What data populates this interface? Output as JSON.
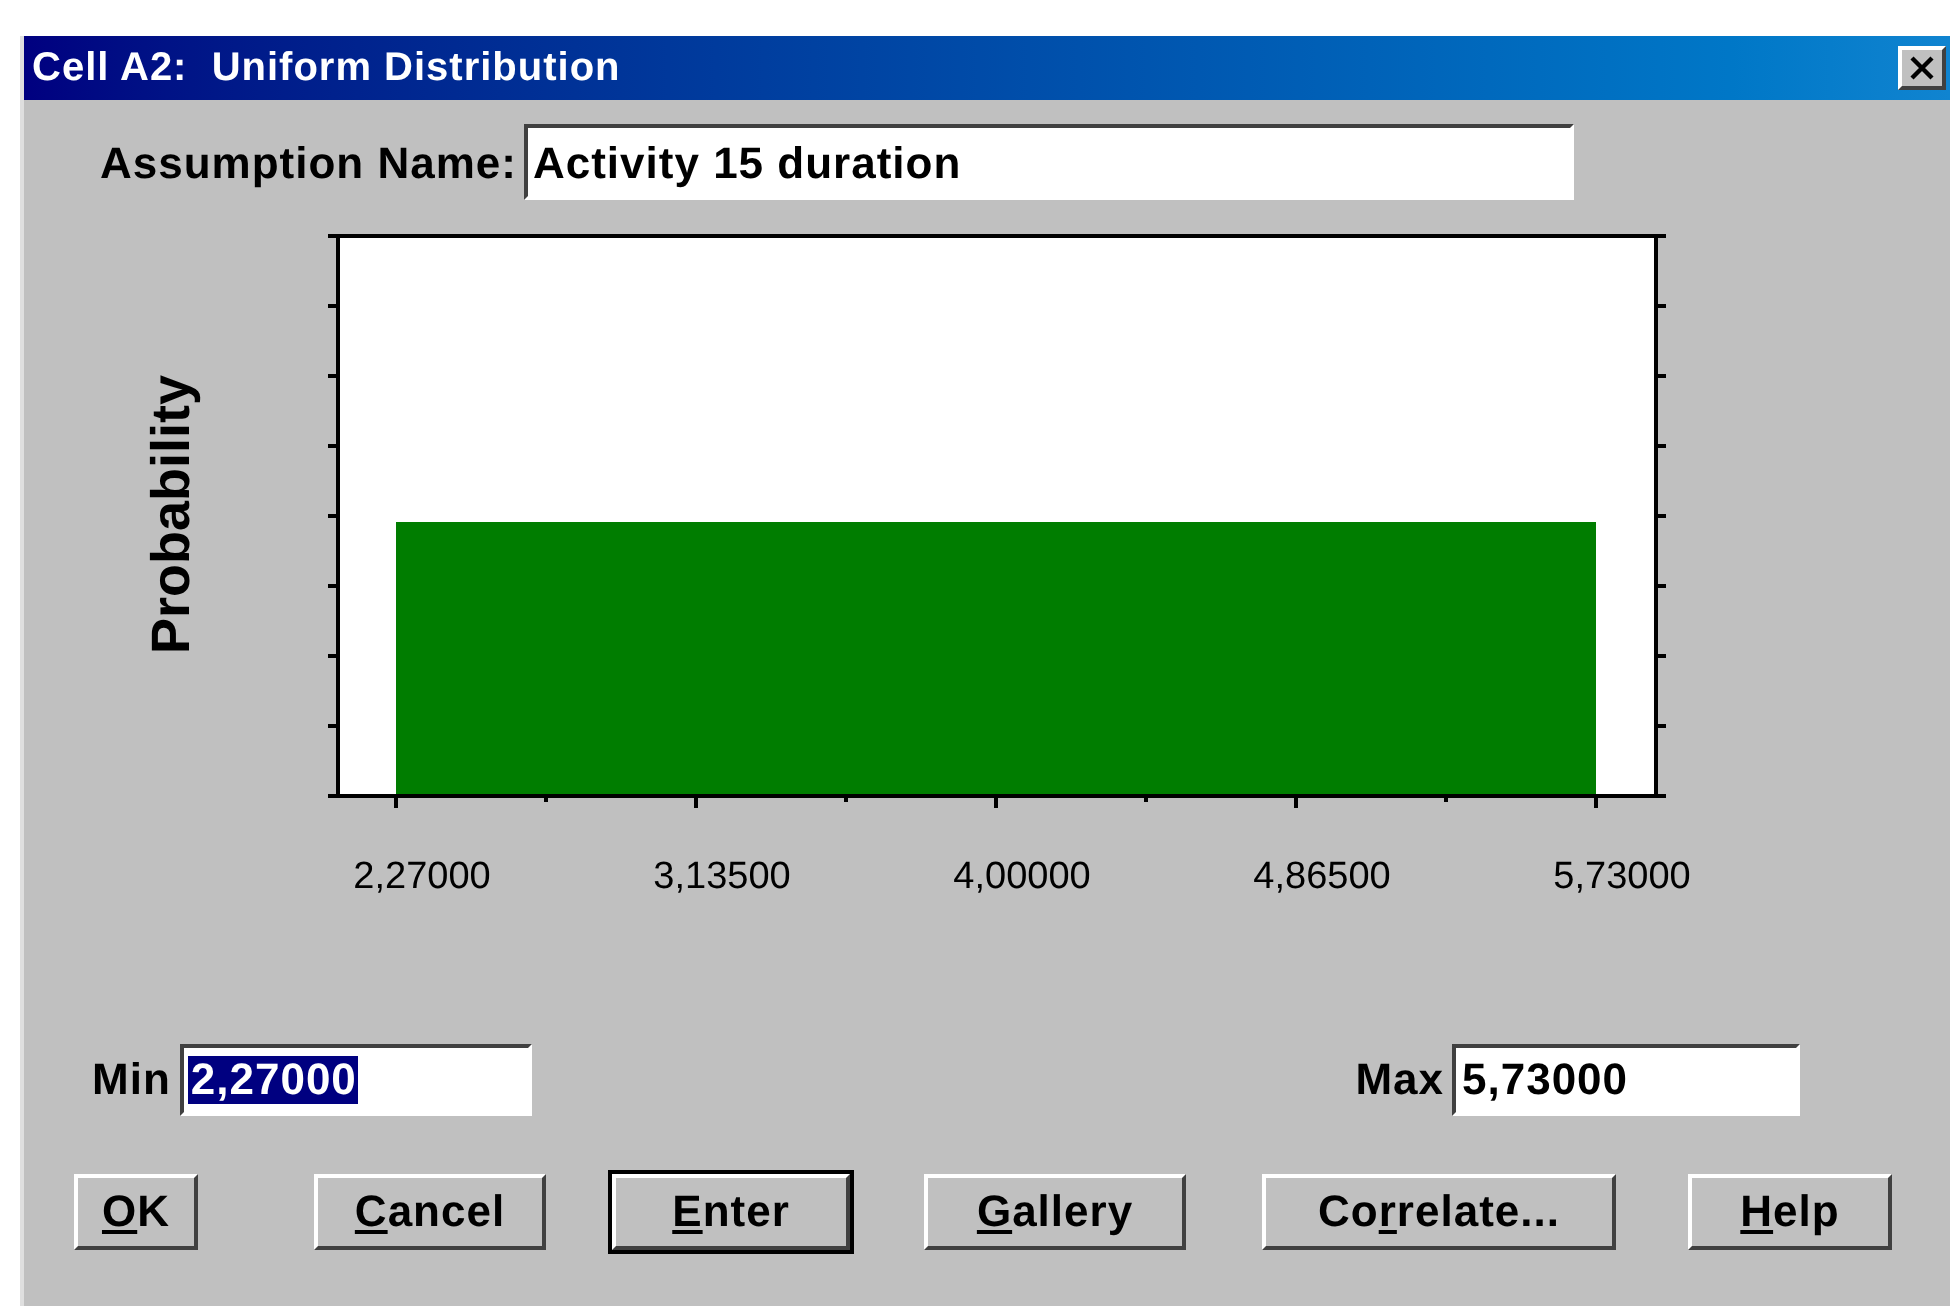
{
  "window": {
    "title": "Cell A2:  Uniform Distribution"
  },
  "assumption_name": {
    "label": "Assumption Name:",
    "value": "Activity 15 duration"
  },
  "chart": {
    "ylabel": "Probability",
    "xtick_labels": [
      "2,27000",
      "3,13500",
      "4,00000",
      "4,86500",
      "5,73000"
    ]
  },
  "min": {
    "label": "Min",
    "value": "2,27000",
    "selected": true
  },
  "max": {
    "label": "Max",
    "value": "5,73000",
    "selected": false
  },
  "buttons": [
    {
      "access_key": "O",
      "label_after": "K",
      "default": false
    },
    {
      "access_key": "C",
      "label_after": "ancel",
      "default": false
    },
    {
      "access_key": "E",
      "label_after": "nter",
      "default": true
    },
    {
      "access_key": "G",
      "label_after": "allery",
      "default": false
    },
    {
      "label_before": "Co",
      "access_key": "r",
      "label_after": "relate...",
      "default": false
    },
    {
      "access_key": "H",
      "label_after": "elp",
      "default": false
    }
  ]
}
